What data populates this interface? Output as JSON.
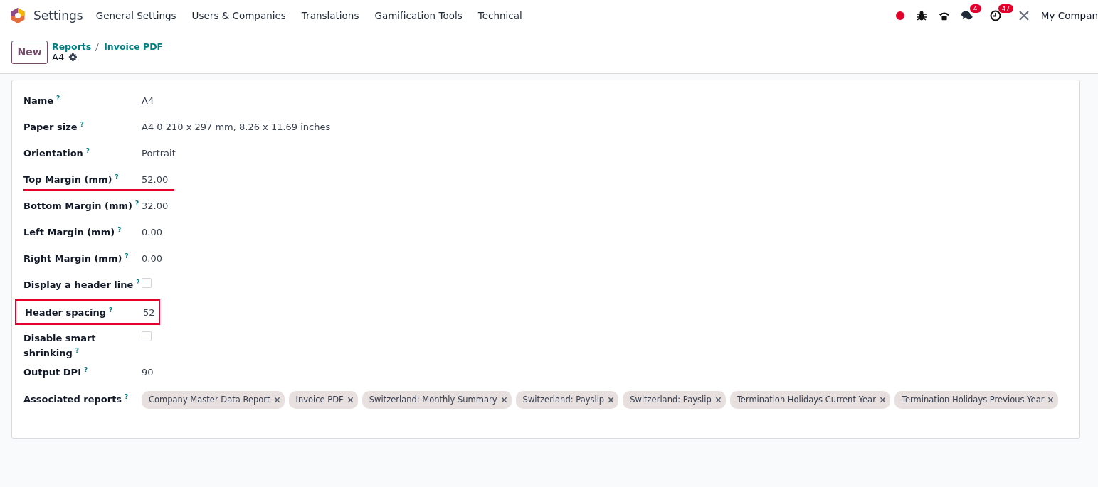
{
  "navbar": {
    "app_name": "Settings",
    "menus": [
      "General Settings",
      "Users & Companies",
      "Translations",
      "Gamification Tools",
      "Technical"
    ],
    "messages_badge": "4",
    "activities_badge": "47",
    "company": "My Compan"
  },
  "control_panel": {
    "new_button": "New",
    "breadcrumbs": [
      "Reports",
      "Invoice PDF"
    ],
    "record": "A4"
  },
  "fields": [
    {
      "kind": "text",
      "label": "Name",
      "help": "?",
      "value": "A4"
    },
    {
      "kind": "text",
      "label": "Paper size",
      "help": "?",
      "value": "A4 0 210 x 297 mm, 8.26 x 11.69 inches"
    },
    {
      "kind": "text",
      "label": "Orientation",
      "help": "?",
      "value": "Portrait"
    },
    {
      "kind": "text",
      "label": "Top Margin (mm)",
      "help": "?",
      "value": "52.00",
      "underlined": true
    },
    {
      "kind": "text",
      "label": "Bottom Margin (mm)",
      "help": "?",
      "value": "32.00"
    },
    {
      "kind": "text",
      "label": "Left Margin (mm)",
      "help": "?",
      "value": "0.00"
    },
    {
      "kind": "text",
      "label": "Right Margin (mm)",
      "help": "?",
      "value": "0.00"
    },
    {
      "kind": "checkbox",
      "label": "Display a header line",
      "help": "?",
      "checked": false
    },
    {
      "kind": "text",
      "label": "Header spacing",
      "help": "?",
      "value": "52",
      "boxed": true
    },
    {
      "kind": "checkbox",
      "label": "Disable smart shrinking",
      "help": "?",
      "checked": false
    },
    {
      "kind": "text",
      "label": "Output DPI",
      "help": "?",
      "value": "90"
    },
    {
      "kind": "tags",
      "label": "Associated reports",
      "help": "?",
      "tags": [
        "Company Master Data Report",
        "Invoice PDF",
        "Switzerland: Monthly Summary",
        "Switzerland: Payslip",
        "Switzerland: Payslip",
        "Termination Holidays Current Year",
        "Termination Holidays Previous Year"
      ]
    }
  ]
}
